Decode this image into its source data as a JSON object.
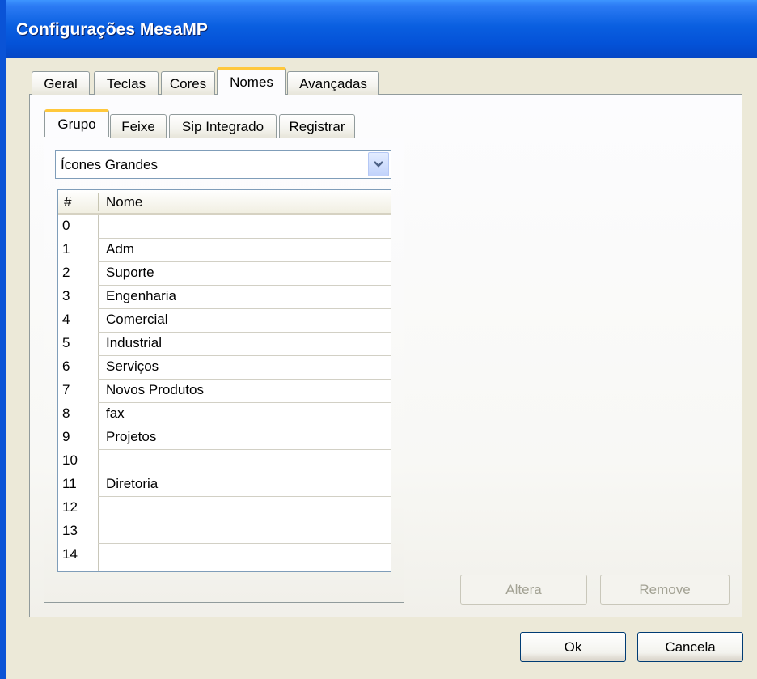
{
  "window": {
    "title": "Configurações MesaMP"
  },
  "main_tabs": [
    {
      "label": "Geral"
    },
    {
      "label": "Teclas"
    },
    {
      "label": "Cores"
    },
    {
      "label": "Nomes"
    },
    {
      "label": "Avançadas"
    }
  ],
  "sub_tabs": [
    {
      "label": "Grupo"
    },
    {
      "label": "Feixe"
    },
    {
      "label": "Sip Integrado"
    },
    {
      "label": "Registrar"
    }
  ],
  "view_select": {
    "value": "Ícones Grandes"
  },
  "list": {
    "headers": {
      "num": "#",
      "name": "Nome"
    },
    "rows": [
      {
        "num": "0",
        "name": ""
      },
      {
        "num": "1",
        "name": "Adm"
      },
      {
        "num": "2",
        "name": "Suporte"
      },
      {
        "num": "3",
        "name": "Engenharia"
      },
      {
        "num": "4",
        "name": "Comercial"
      },
      {
        "num": "5",
        "name": "Industrial"
      },
      {
        "num": "6",
        "name": "Serviços"
      },
      {
        "num": "7",
        "name": "Novos Produtos"
      },
      {
        "num": "8",
        "name": "fax"
      },
      {
        "num": "9",
        "name": "Projetos"
      },
      {
        "num": "10",
        "name": ""
      },
      {
        "num": "11",
        "name": "Diretoria"
      },
      {
        "num": "12",
        "name": ""
      },
      {
        "num": "13",
        "name": ""
      },
      {
        "num": "14",
        "name": ""
      }
    ]
  },
  "buttons": {
    "altera": "Altera",
    "remove": "Remove",
    "ok": "Ok",
    "cancela": "Cancela"
  },
  "icons": {
    "dropdown": "chevron-down-icon"
  },
  "colors": {
    "titlebar": "#0452D8",
    "active_tab_accent": "#FFC83C",
    "window_bg": "#ECE9D8"
  }
}
